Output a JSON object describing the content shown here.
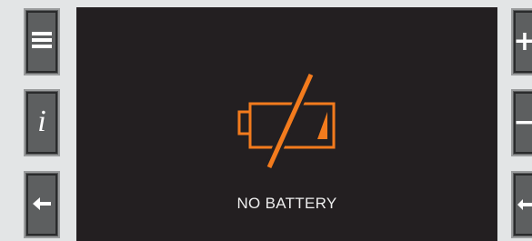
{
  "screen": {
    "status_text": "NO BATTERY",
    "icon": "no-battery-icon",
    "background": "#231f21",
    "accent": "#f37b1d"
  },
  "left_buttons": [
    {
      "icon": "menu-icon"
    },
    {
      "icon": "info-icon",
      "glyph": "i"
    },
    {
      "icon": "back-arrow-icon"
    }
  ],
  "right_buttons": [
    {
      "icon": "plus-icon",
      "glyph": "+"
    },
    {
      "icon": "minus-icon",
      "glyph": "−"
    },
    {
      "icon": "enter-icon"
    }
  ]
}
